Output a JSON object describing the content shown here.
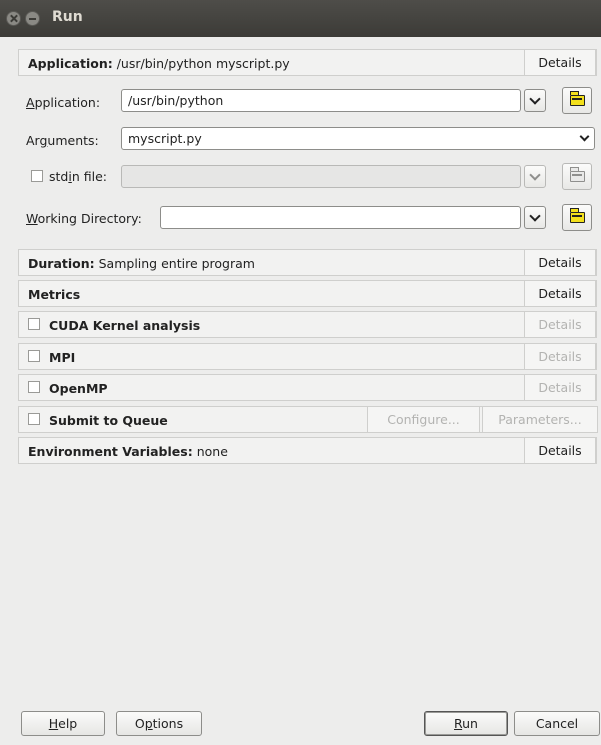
{
  "window": {
    "title": "Run"
  },
  "application_section": {
    "header_label": "Application:",
    "header_value": "/usr/bin/python myscript.py",
    "details_label": "Details",
    "application_label_pre": "",
    "application_label_u": "A",
    "application_label_post": "pplication:",
    "application_value": "/usr/bin/python",
    "arguments_label_pre": "Ar",
    "arguments_label_u": "g",
    "arguments_label_post": "uments:",
    "arguments_value": "myscript.py",
    "stdin_label_pre": "std",
    "stdin_label_u": "i",
    "stdin_label_post": "n file:",
    "stdin_value": "",
    "workdir_label_pre": "",
    "workdir_label_u": "W",
    "workdir_label_post": "orking Directory:",
    "workdir_value": ""
  },
  "duration": {
    "label": "Duration:",
    "value": "Sampling entire program",
    "details_label": "Details"
  },
  "metrics": {
    "label": "Metrics",
    "details_label": "Details"
  },
  "cuda": {
    "label": "CUDA Kernel analysis",
    "details_label": "Details"
  },
  "mpi": {
    "label": "MPI",
    "details_label": "Details"
  },
  "openmp": {
    "label": "OpenMP",
    "details_label": "Details"
  },
  "queue": {
    "label": "Submit to Queue",
    "configure_label": "Configure...",
    "parameters_label": "Parameters..."
  },
  "env": {
    "label": "Environment Variables:",
    "value": "none",
    "details_label": "Details"
  },
  "footer": {
    "help_pre": "",
    "help_u": "H",
    "help_post": "elp",
    "options_pre": "O",
    "options_u": "p",
    "options_post": "tions",
    "run_pre": "",
    "run_u": "R",
    "run_post": "un",
    "cancel_label": "Cancel"
  },
  "colors": {
    "titlebar": "#3c3b37",
    "window_bg": "#ededec",
    "folder_icon": "#f3e01c",
    "disabled_text": "#b3b3b1"
  }
}
